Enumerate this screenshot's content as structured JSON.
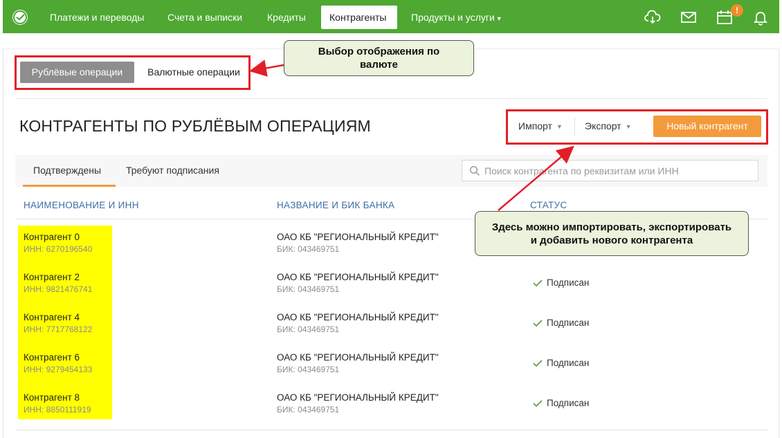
{
  "nav": {
    "items": [
      {
        "label": "Платежи и переводы"
      },
      {
        "label": "Счета и выписки"
      },
      {
        "label": "Кредиты"
      },
      {
        "label": "Контрагенты"
      },
      {
        "label": "Продукты и услуги"
      }
    ],
    "notification_count": "!"
  },
  "currency_switch": {
    "ruble": "Рублёвые операции",
    "foreign": "Валютные операции"
  },
  "page": {
    "title": "КОНТРАГЕНТЫ ПО РУБЛЁВЫМ ОПЕРАЦИЯМ"
  },
  "actions": {
    "import": "Импорт",
    "export": "Экспорт",
    "new": "Новый контрагент"
  },
  "tabs": {
    "confirmed": "Подтверждены",
    "needs_signing": "Требуют подписания"
  },
  "search": {
    "placeholder": "Поиск контрагента по реквизитам или ИНН"
  },
  "table": {
    "headers": [
      "НАИМЕНОВАНИЕ И ИНН",
      "НАЗВАНИЕ И БИК БАНКА",
      "СТАТУС"
    ],
    "rows": [
      {
        "name": "Контрагент 0",
        "inn": "ИНН: 6270196540",
        "bank": "ОАО КБ \"РЕГИОНАЛЬНЫЙ КРЕДИТ\"",
        "bik": "БИК: 043469751",
        "status": ""
      },
      {
        "name": "Контрагент 2",
        "inn": "ИНН: 9821476741",
        "bank": "ОАО КБ \"РЕГИОНАЛЬНЫЙ КРЕДИТ\"",
        "bik": "БИК: 043469751",
        "status": "Подписан"
      },
      {
        "name": "Контрагент 4",
        "inn": "ИНН: 7717768122",
        "bank": "ОАО КБ \"РЕГИОНАЛЬНЫЙ КРЕДИТ\"",
        "bik": "БИК: 043469751",
        "status": "Подписан"
      },
      {
        "name": "Контрагент 6",
        "inn": "ИНН: 9279454133",
        "bank": "ОАО КБ \"РЕГИОНАЛЬНЫЙ КРЕДИТ\"",
        "bik": "БИК: 043469751",
        "status": "Подписан"
      },
      {
        "name": "Контрагент 8",
        "inn": "ИНН: 8850111919",
        "bank": "ОАО КБ \"РЕГИОНАЛЬНЫЙ КРЕДИТ\"",
        "bik": "БИК: 043469751",
        "status": "Подписан"
      }
    ]
  },
  "annotations": {
    "currency": [
      "Выбор отображения по",
      "валюте"
    ],
    "actions": [
      "Здесь можно импортировать, экспортировать",
      "и добавить нового контрагента"
    ]
  },
  "colors": {
    "nav_green": "#4ea832",
    "accent_orange": "#f39a3c",
    "highlight_red": "#e21f26",
    "highlight_yellow": "#ffff00",
    "callout_bg": "#ebf3dc",
    "header_blue": "#3f6ea8"
  },
  "icons": [
    "sberbank-logo-icon",
    "cloud-download-icon",
    "mail-icon",
    "calendar-icon",
    "bell-icon",
    "search-icon",
    "check-icon"
  ]
}
